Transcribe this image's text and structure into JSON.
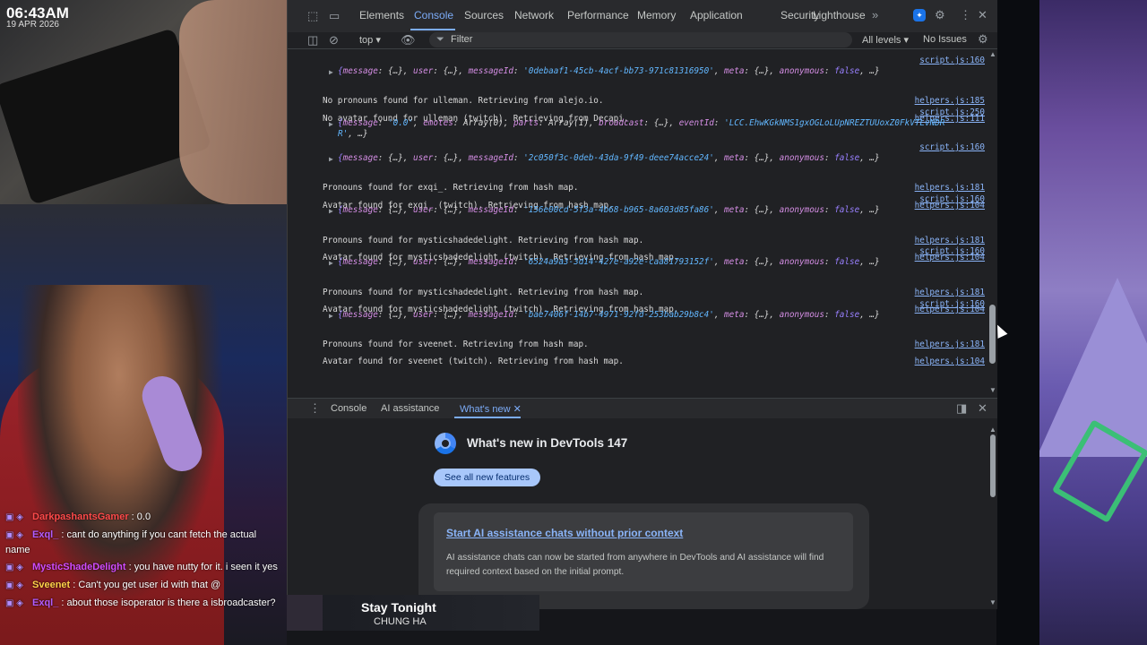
{
  "overlay": {
    "time": "06:43AM",
    "date": "19 APR 2026"
  },
  "devtools": {
    "top_tabs": [
      "Elements",
      "Console",
      "Sources",
      "Network",
      "Performance",
      "Memory",
      "Application",
      "Security",
      "Lighthouse"
    ],
    "active_tab": "Console",
    "context_select": "top",
    "filter_placeholder": "Filter",
    "levels_select": "All levels",
    "issues": "No Issues",
    "log_rows": [
      {
        "kind": "obj",
        "y": 0,
        "src": "script.js:160",
        "parts": [
          [
            "b",
            "{"
          ],
          [
            "k",
            "message"
          ],
          [
            "v",
            ": {…}, "
          ],
          [
            "k",
            "user"
          ],
          [
            "v",
            ": {…}, "
          ],
          [
            "k",
            "messageId"
          ],
          [
            "v",
            ": "
          ],
          [
            "s",
            "'0debaaf1-45cb-4acf-bb73-971c81316950'"
          ],
          [
            "v",
            ", "
          ],
          [
            "k",
            "meta"
          ],
          [
            "v",
            ": {…}, "
          ],
          [
            "k",
            "anonymous"
          ],
          [
            "v",
            ": "
          ],
          [
            "b",
            "false"
          ],
          [
            "v",
            ", …}"
          ]
        ]
      },
      {
        "kind": "msg",
        "y": 1,
        "text": "No pronouns found for ulleman. Retrieving from alejo.io.",
        "src": "helpers.js:185"
      },
      {
        "kind": "msg",
        "y": 2,
        "text": "No avatar found for ulleman (twitch). Retrieving from Decapi.",
        "src": "helpers.js:111"
      },
      {
        "kind": "obj2",
        "y": 3,
        "src": "script.js:250",
        "line1": [
          [
            "b",
            "{"
          ],
          [
            "k",
            "message"
          ],
          [
            "v",
            ": "
          ],
          [
            "s",
            "'0.0'"
          ],
          [
            "v",
            ", "
          ],
          [
            "k",
            "emotes"
          ],
          [
            "v",
            ": Array(0), "
          ],
          [
            "k",
            "parts"
          ],
          [
            "v",
            ": Array(1), "
          ],
          [
            "k",
            "broadcast"
          ],
          [
            "v",
            ": {…}, "
          ],
          [
            "k",
            "eventId"
          ],
          [
            "v",
            ": "
          ],
          [
            "s",
            "'LCC.EhwKGkNMS1gxOGLoLUpNREZTUUoxZ0FkVTLvNDR"
          ]
        ],
        "line2": [
          [
            "s",
            "R'"
          ],
          [
            "v",
            ", …}"
          ]
        ]
      },
      {
        "kind": "obj",
        "y": 5,
        "src": "script.js:160",
        "parts": [
          [
            "b",
            "{"
          ],
          [
            "k",
            "message"
          ],
          [
            "v",
            ": {…}, "
          ],
          [
            "k",
            "user"
          ],
          [
            "v",
            ": {…}, "
          ],
          [
            "k",
            "messageId"
          ],
          [
            "v",
            ": "
          ],
          [
            "s",
            "'2c050f3c-0deb-43da-9f49-deee74acce24'"
          ],
          [
            "v",
            ", "
          ],
          [
            "k",
            "meta"
          ],
          [
            "v",
            ": {…}, "
          ],
          [
            "k",
            "anonymous"
          ],
          [
            "v",
            ": "
          ],
          [
            "b",
            "false"
          ],
          [
            "v",
            ", …}"
          ]
        ]
      },
      {
        "kind": "msg",
        "y": 6,
        "text": "Pronouns found for exqi_. Retrieving from hash map.",
        "src": "helpers.js:181"
      },
      {
        "kind": "msg",
        "y": 7,
        "text": "Avatar found for exqi_ (twitch). Retrieving from hash map.",
        "src": "helpers.js:104"
      },
      {
        "kind": "obj",
        "y": 8,
        "src": "script.js:160",
        "parts": [
          [
            "b",
            "{"
          ],
          [
            "k",
            "message"
          ],
          [
            "v",
            ": {…}, "
          ],
          [
            "k",
            "user"
          ],
          [
            "v",
            ": {…}, "
          ],
          [
            "k",
            "messageId"
          ],
          [
            "v",
            ": "
          ],
          [
            "s",
            "'156e00cd-5f3a-4b68-b965-8a603d85fa86'"
          ],
          [
            "v",
            ", "
          ],
          [
            "k",
            "meta"
          ],
          [
            "v",
            ": {…}, "
          ],
          [
            "k",
            "anonymous"
          ],
          [
            "v",
            ": "
          ],
          [
            "b",
            "false"
          ],
          [
            "v",
            ", …}"
          ]
        ]
      },
      {
        "kind": "msg",
        "y": 9,
        "text": "Pronouns found for mysticshadedelight. Retrieving from hash map.",
        "src": "helpers.js:181"
      },
      {
        "kind": "msg",
        "y": 10,
        "text": "Avatar found for mysticshadedelight (twitch). Retrieving from hash map.",
        "src": "helpers.js:104"
      },
      {
        "kind": "obj",
        "y": 11,
        "src": "script.js:160",
        "parts": [
          [
            "b",
            "{"
          ],
          [
            "k",
            "message"
          ],
          [
            "v",
            ": {…}, "
          ],
          [
            "k",
            "user"
          ],
          [
            "v",
            ": {…}, "
          ],
          [
            "k",
            "messageId"
          ],
          [
            "v",
            ": "
          ],
          [
            "s",
            "'6524a9a3-3d14-427e-a92e-caa81793152f'"
          ],
          [
            "v",
            ", "
          ],
          [
            "k",
            "meta"
          ],
          [
            "v",
            ": {…}, "
          ],
          [
            "k",
            "anonymous"
          ],
          [
            "v",
            ": "
          ],
          [
            "b",
            "false"
          ],
          [
            "v",
            ", …}"
          ]
        ]
      },
      {
        "kind": "msg",
        "y": 12,
        "text": "Pronouns found for mysticshadedelight. Retrieving from hash map.",
        "src": "helpers.js:181"
      },
      {
        "kind": "msg",
        "y": 13,
        "text": "Avatar found for mysticshadedelight (twitch). Retrieving from hash map.",
        "src": "helpers.js:104"
      },
      {
        "kind": "obj",
        "y": 14,
        "src": "script.js:160",
        "parts": [
          [
            "b",
            "{"
          ],
          [
            "k",
            "message"
          ],
          [
            "v",
            ": {…}, "
          ],
          [
            "k",
            "user"
          ],
          [
            "v",
            ": {…}, "
          ],
          [
            "k",
            "messageId"
          ],
          [
            "v",
            ": "
          ],
          [
            "s",
            "'bae7406f-14b7-4971-92fd-253bab29b8c4'"
          ],
          [
            "v",
            ", "
          ],
          [
            "k",
            "meta"
          ],
          [
            "v",
            ": {…}, "
          ],
          [
            "k",
            "anonymous"
          ],
          [
            "v",
            ": "
          ],
          [
            "b",
            "false"
          ],
          [
            "v",
            ", …}"
          ]
        ]
      },
      {
        "kind": "msg",
        "y": 15,
        "text": "Pronouns found for sveenet. Retrieving from hash map.",
        "src": "helpers.js:181"
      },
      {
        "kind": "msg",
        "y": 16,
        "text": "Avatar found for sveenet (twitch). Retrieving from hash map.",
        "src": "helpers.js:104"
      }
    ],
    "drawer_tabs": [
      "Console",
      "AI assistance",
      "What's new"
    ],
    "drawer_active": "What's new",
    "whats_new": {
      "title": "What's new in DevTools 147",
      "button": "See all new features",
      "card_title": "Start AI assistance chats without prior context",
      "card_body": "AI assistance chats can now be started from anywhere in DevTools and AI assistance will find required context based on the initial prompt."
    }
  },
  "chat": [
    {
      "user": "DarkpashantsGamer",
      "color": "#ff4a4a",
      "text": ": 0.0"
    },
    {
      "user": "Exql_",
      "color": "#b25cff",
      "text": ": cant do anything if you cant fetch the actual name"
    },
    {
      "user": "MysticShadeDelight",
      "color": "#d04cff",
      "text": ": you have nutty for it. i seen it yes"
    },
    {
      "user": "Sveenet",
      "color": "#ffd24a",
      "text": ": Can't you get user id with that @"
    },
    {
      "user": "Exql_",
      "color": "#b25cff",
      "text": ": about those isoperator is there a isbroadcaster?"
    }
  ],
  "now_playing": {
    "title": "Stay Tonight",
    "artist": "CHUNG HA"
  }
}
